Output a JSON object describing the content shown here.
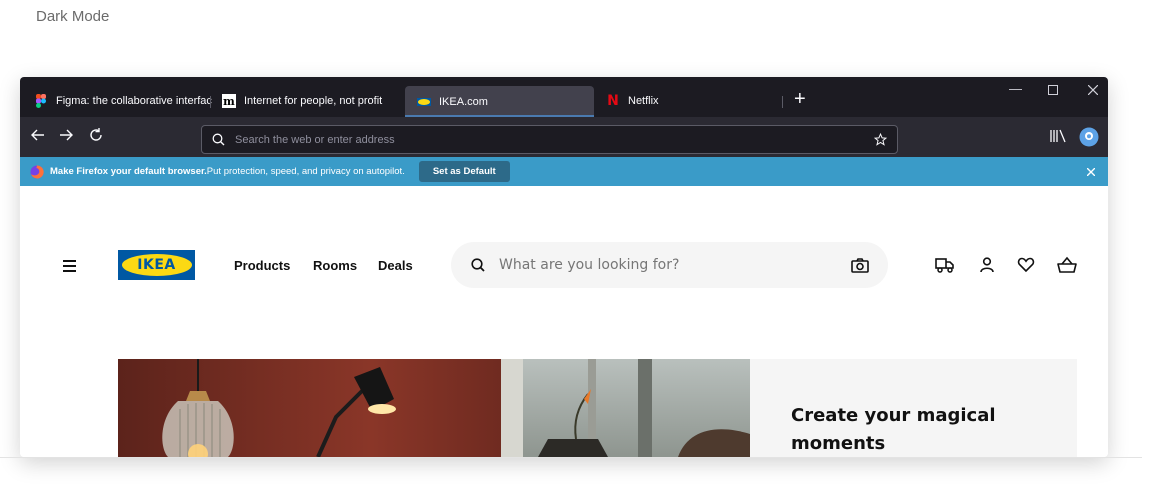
{
  "page": {
    "label": "Dark Mode"
  },
  "browser": {
    "tabs": [
      {
        "title": "Figma: the collaborative interfac",
        "icon": "figma-icon"
      },
      {
        "title": "Internet for people, not profit",
        "icon": "mozilla-icon"
      },
      {
        "title": "IKEA.com",
        "icon": "ikea-icon",
        "active": true
      },
      {
        "title": "Netflix",
        "icon": "netflix-icon"
      }
    ],
    "url_placeholder": "Search the web or enter address",
    "notification": {
      "bold": "Make Firefox your default browser.",
      "text": " Put protection, speed, and privacy on autopilot.",
      "button": "Set as Default"
    },
    "colors": {
      "tabstrip": "#1c1b22",
      "toolbar": "#2b2a33",
      "notification": "#3a9bc8",
      "active_tab": "#42414d"
    }
  },
  "site": {
    "logo": "IKEA",
    "nav": [
      "Products",
      "Rooms",
      "Deals"
    ],
    "search_placeholder": "What are you looking for?",
    "hero": {
      "title": "Create your magical moments"
    },
    "colors": {
      "ikea_blue": "#0058a3",
      "ikea_yellow": "#fbd914"
    }
  }
}
